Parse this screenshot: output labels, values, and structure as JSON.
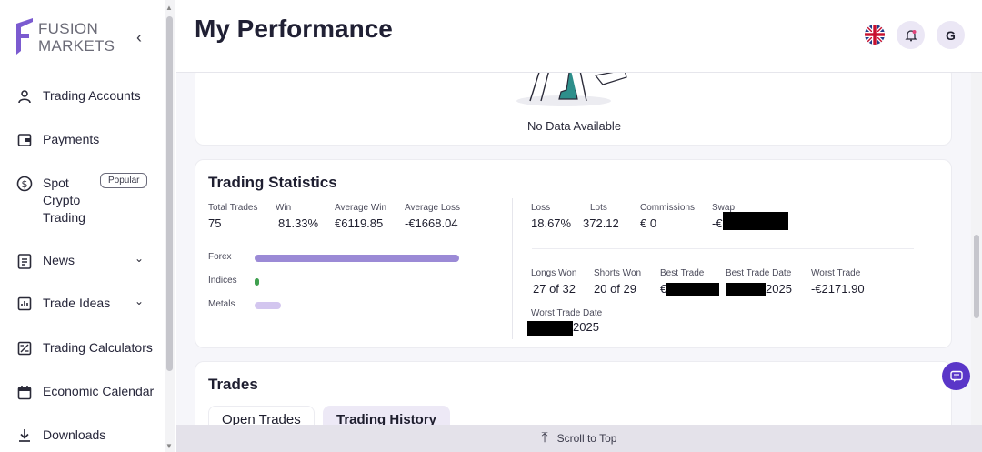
{
  "brand": {
    "line1": "FUSION",
    "line2": "MARKETS",
    "accent": "#7b5bd0"
  },
  "sidebar": {
    "items": [
      {
        "label": "Trading Accounts",
        "icon": "user-icon"
      },
      {
        "label": "Payments",
        "icon": "wallet-icon"
      },
      {
        "label": "Spot Crypto Trading",
        "icon": "dollar-circle-icon",
        "badge": "Popular"
      },
      {
        "label": "News",
        "icon": "news-icon"
      },
      {
        "label": "Trade Ideas",
        "icon": "chart-icon"
      },
      {
        "label": "Trading Calculators",
        "icon": "calculator-icon"
      },
      {
        "label": "Economic Calendar",
        "icon": "calendar-icon"
      },
      {
        "label": "Downloads",
        "icon": "download-icon"
      }
    ],
    "spot_line1": "Spot",
    "spot_line2": "Crypto",
    "spot_line3": "Trading"
  },
  "header": {
    "title": "My Performance",
    "avatar_initial": "G"
  },
  "no_data": {
    "text": "No Data Available"
  },
  "stats": {
    "title": "Trading Statistics",
    "left": [
      {
        "key": "Total Trades",
        "value": "75"
      },
      {
        "key": "Win",
        "value": "81.33%"
      },
      {
        "key": "Average Win",
        "value": "€6119.85"
      },
      {
        "key": "Average Loss",
        "value": "-€1668.04"
      }
    ],
    "bars": [
      {
        "label": "Forex",
        "fraction": 1.0,
        "color": "#9b8ad6"
      },
      {
        "label": "Indices",
        "fraction": 0.02,
        "color": "#3fa04f"
      },
      {
        "label": "Metals",
        "fraction": 0.13,
        "color": "#d3c6ef"
      }
    ],
    "right_top": [
      {
        "key": "Loss",
        "value": "18.67%"
      },
      {
        "key": "Lots",
        "value": "372.12"
      },
      {
        "key": "Commissions",
        "value": "€ 0"
      },
      {
        "key": "Swap",
        "value": "-€"
      }
    ],
    "right_bottom": [
      {
        "key": "Longs Won",
        "value": "27 of 32"
      },
      {
        "key": "Shorts Won",
        "value": "20 of 29"
      },
      {
        "key": "Best Trade",
        "value": "€"
      },
      {
        "key": "Best Trade Date",
        "value": "2025"
      },
      {
        "key": "Worst Trade",
        "value": "-€2171.90"
      }
    ],
    "worst_trade_date": {
      "key": "Worst Trade Date",
      "value": "2025"
    }
  },
  "trades": {
    "title": "Trades",
    "tabs": [
      "Open Trades",
      "Trading History"
    ],
    "active_tab": "Trading History"
  },
  "footer": {
    "scroll_label": "Scroll to Top"
  }
}
